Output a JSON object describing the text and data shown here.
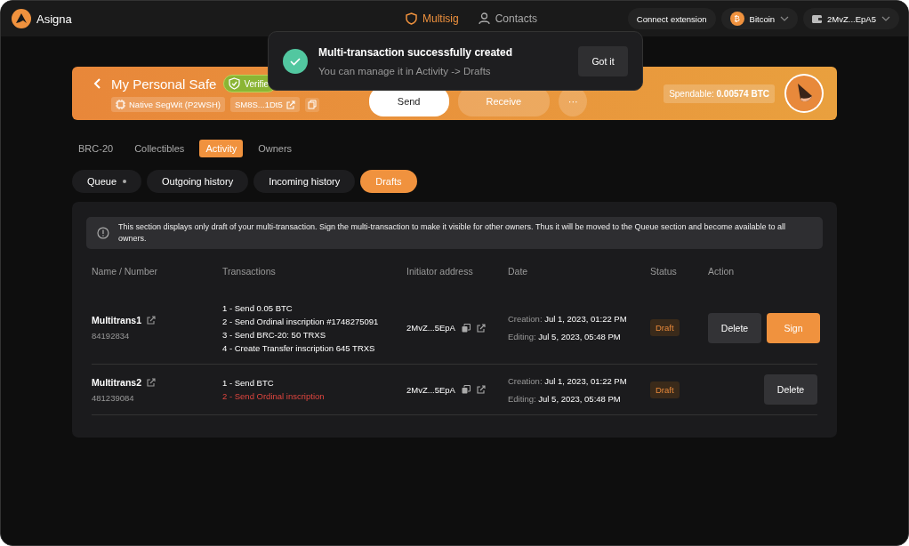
{
  "topbar": {
    "brand": "Asigna",
    "nav": [
      {
        "label": "Multisig",
        "selected": true,
        "kind": "shield"
      },
      {
        "label": "Contacts",
        "selected": false,
        "kind": "person"
      }
    ],
    "connect": "Connect extension",
    "network": {
      "label": "Bitcoin",
      "symbol": "₿"
    },
    "wallet": "2MvZ...EpA5"
  },
  "toast": {
    "title": "Multi-transaction successfully created",
    "message": "You can manage it in Activity -> Drafts",
    "button": "Got it"
  },
  "safe": {
    "name": "My Personal Safe",
    "badge": "Verifie",
    "type": "Native SegWit (P2WSH)",
    "address": "SM8S...1Dt5",
    "actions": [
      "Send",
      "Receive",
      "···"
    ],
    "spendable_label": "Spendable:",
    "spendable": "0.00574 BTC"
  },
  "tabs": [
    {
      "label": "BRC-20",
      "selected": false
    },
    {
      "label": "Collectibles",
      "selected": false
    },
    {
      "label": "Activity",
      "selected": true
    },
    {
      "label": "Owners",
      "selected": false
    }
  ],
  "subtabs": [
    {
      "label": "Queue",
      "selected": false,
      "dot": true
    },
    {
      "label": "Outgoing history",
      "selected": false,
      "dot": false
    },
    {
      "label": "Incoming history",
      "selected": false,
      "dot": false
    },
    {
      "label": "Drafts",
      "selected": true,
      "dot": false
    }
  ],
  "notice": "This section displays only draft of your multi-transaction. Sign the multi-transaction to make it visible for other owners. Thus it will be moved to the Queue section and become available to all owners.",
  "table": {
    "columns": [
      "Name / Number",
      "Transactions",
      "Initiator address",
      "Date",
      "Status",
      "Action"
    ],
    "rows": [
      {
        "name": "Multitrans1",
        "number": "84192834",
        "transactions": [
          {
            "text": "1 - Send 0.05 BTC",
            "failed": false
          },
          {
            "text": "2 - Send Ordinal inscription #1748275091",
            "failed": false
          },
          {
            "text": "3 - Send BRC-20: 50 TRXS",
            "failed": false
          },
          {
            "text": "4 - Create Transfer inscription 645 TRXS",
            "failed": false
          }
        ],
        "initiator": "2MvZ...5EpA",
        "creation_label": "Creation:",
        "creation": "Jul 1, 2023, 01:22 PM",
        "editing_label": "Editing:",
        "editing": "Jul 5, 2023, 05:48 PM",
        "status": "Draft",
        "actions": [
          {
            "label": "Delete",
            "kind": "delete"
          },
          {
            "label": "Sign",
            "kind": "sign"
          }
        ]
      },
      {
        "name": "Multitrans2",
        "number": "481239084",
        "transactions": [
          {
            "text": "1 - Send BTC",
            "failed": false
          },
          {
            "text": "2 - Send Ordinal inscription",
            "failed": true
          }
        ],
        "initiator": "2MvZ...5EpA",
        "creation_label": "Creation:",
        "creation": "Jul 1, 2023, 01:22 PM",
        "editing_label": "Editing:",
        "editing": "Jul 5, 2023, 05:48 PM",
        "status": "Draft",
        "actions": [
          {
            "label": "Delete",
            "kind": "delete"
          }
        ]
      }
    ]
  }
}
